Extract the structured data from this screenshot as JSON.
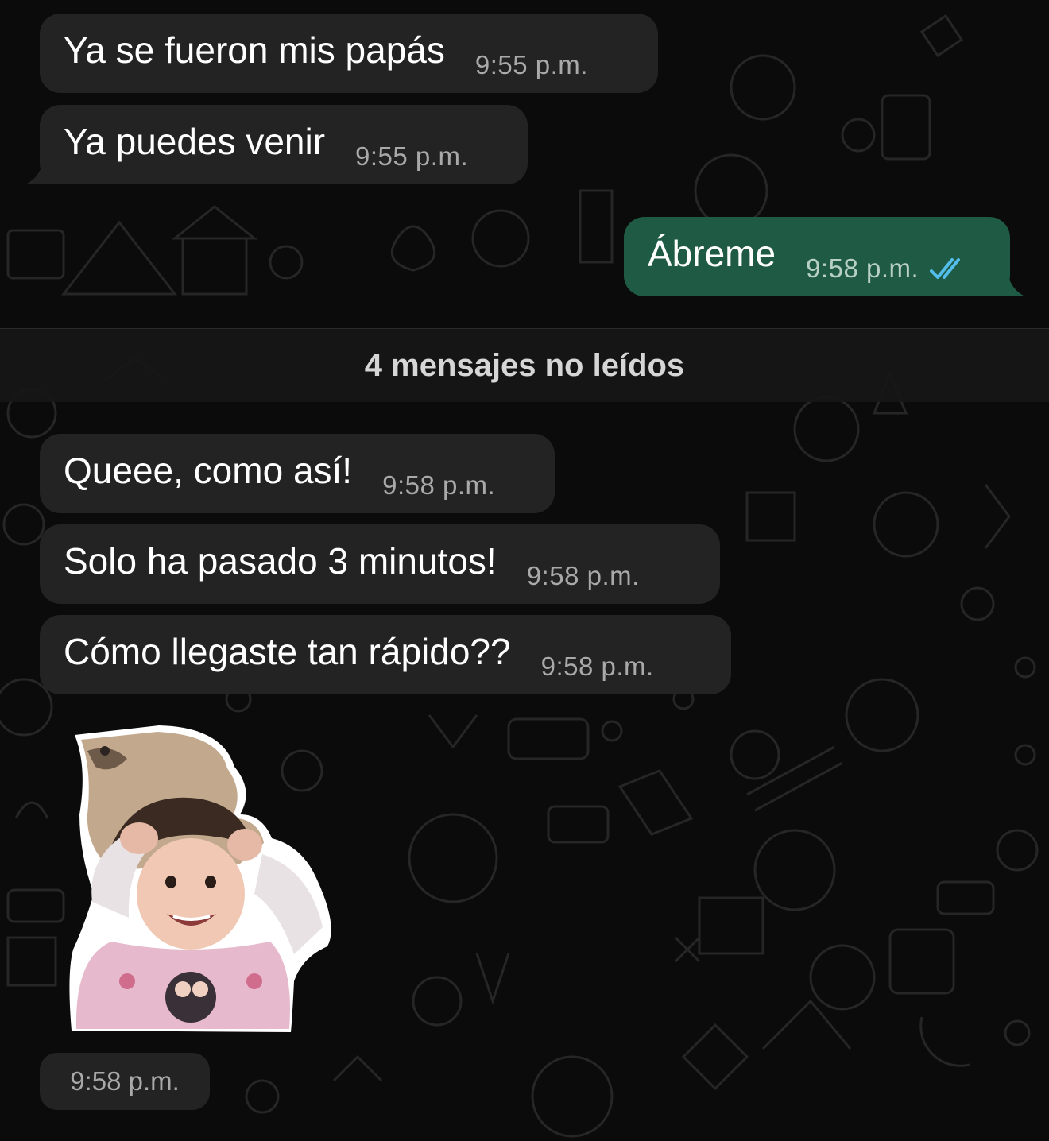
{
  "messages": [
    {
      "text": "Ya se fueron mis papás",
      "time": "9:55 p.m."
    },
    {
      "text": "Ya puedes venir",
      "time": "9:55 p.m."
    },
    {
      "text": "Ábreme",
      "time": "9:58 p.m."
    },
    {
      "text": "Queee, como así!",
      "time": "9:58 p.m."
    },
    {
      "text": "Solo ha pasado 3 minutos!",
      "time": "9:58 p.m."
    },
    {
      "text": "Cómo llegaste tan rápido??",
      "time": "9:58 p.m."
    }
  ],
  "unread_divider": "4 mensajes no leídos",
  "sticker": {
    "time": "9:58 p.m."
  },
  "colors": {
    "background": "#0b0b0b",
    "incoming_bubble": "#232323",
    "outgoing_bubble": "#1f5a45",
    "read_ticks": "#53bdeb"
  }
}
